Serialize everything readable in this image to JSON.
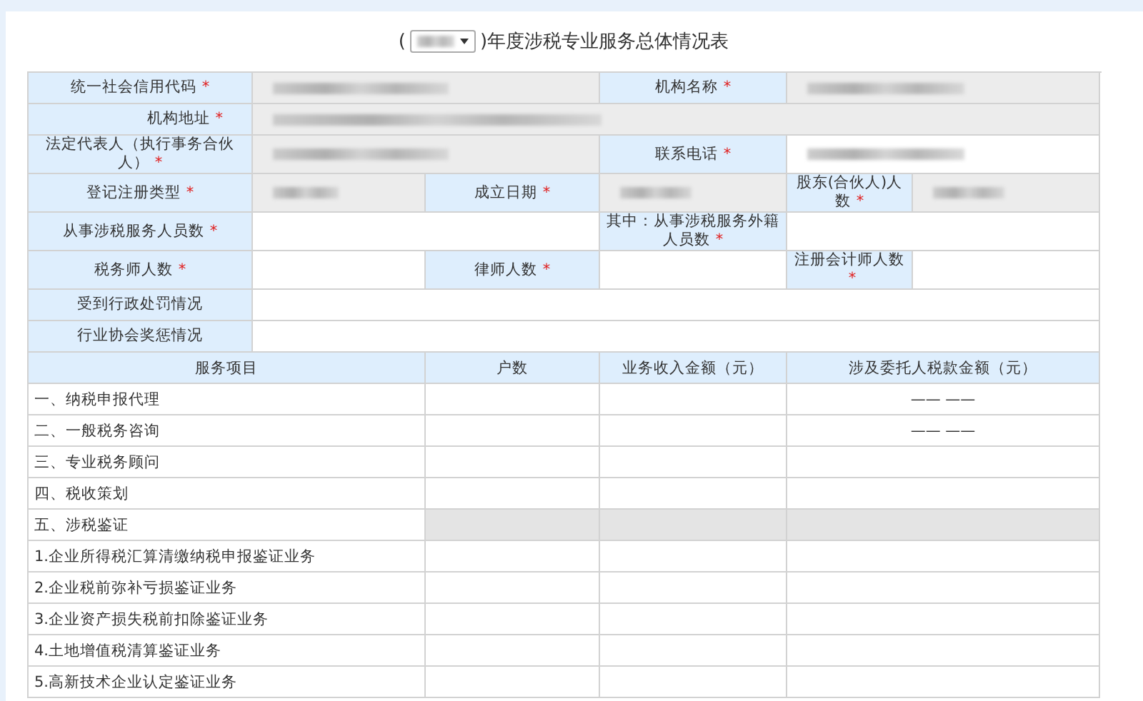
{
  "title": {
    "prefix": "(",
    "suffix": ")年度涉税专业服务总体情况表",
    "year_select": {
      "redacted": true
    }
  },
  "info_rows": [
    {
      "cells": [
        {
          "kind": "label",
          "text": "统一社会信用代码",
          "required_mark": "*"
        },
        {
          "kind": "value",
          "readonly": true,
          "redacted": true
        },
        {
          "kind": "label",
          "text": "机构名称",
          "required_mark": "*"
        },
        {
          "kind": "value",
          "readonly": true,
          "redacted": true
        }
      ]
    },
    {
      "cells": [
        {
          "kind": "label",
          "text": "机构地址",
          "required_mark": "*"
        },
        {
          "kind": "value",
          "readonly": true,
          "redacted": true
        }
      ]
    },
    {
      "cells": [
        {
          "kind": "label",
          "text": "法定代表人（执行事务合伙人）",
          "required_mark": "*"
        },
        {
          "kind": "value",
          "readonly": true,
          "redacted": true
        },
        {
          "kind": "label",
          "text": "联系电话",
          "required_mark": "*"
        },
        {
          "kind": "value",
          "readonly": false,
          "redacted": true
        }
      ]
    },
    {
      "cells": [
        {
          "kind": "label",
          "text": "登记注册类型",
          "required_mark": "*"
        },
        {
          "kind": "value",
          "readonly": true,
          "redacted": true
        },
        {
          "kind": "label",
          "text": "成立日期",
          "required_mark": "*"
        },
        {
          "kind": "value",
          "readonly": true,
          "redacted": true
        },
        {
          "kind": "label",
          "text": "股东(合伙人)人数",
          "required_mark": "*"
        },
        {
          "kind": "value",
          "readonly": true,
          "redacted": true
        }
      ]
    },
    {
      "cells": [
        {
          "kind": "label",
          "text": "从事涉税服务人员数",
          "required_mark": "*"
        },
        {
          "kind": "value",
          "readonly": false,
          "redacted": false
        },
        {
          "kind": "label",
          "text": "其中：从事涉税服务外籍人员数",
          "required_mark": "*"
        },
        {
          "kind": "value",
          "readonly": false,
          "redacted": false
        }
      ]
    },
    {
      "cells": [
        {
          "kind": "label",
          "text": "税务师人数",
          "required_mark": "*"
        },
        {
          "kind": "value",
          "readonly": false,
          "redacted": false
        },
        {
          "kind": "label",
          "text": "律师人数",
          "required_mark": "*"
        },
        {
          "kind": "value",
          "readonly": false,
          "redacted": false
        },
        {
          "kind": "label",
          "text": "注册会计师人数",
          "required_mark": "*"
        },
        {
          "kind": "value",
          "readonly": false,
          "redacted": false
        }
      ]
    },
    {
      "cells": [
        {
          "kind": "label",
          "text": "受到行政处罚情况"
        },
        {
          "kind": "value",
          "readonly": false,
          "redacted": false
        }
      ]
    },
    {
      "cells": [
        {
          "kind": "label",
          "text": "行业协会奖惩情况"
        },
        {
          "kind": "value",
          "readonly": false,
          "redacted": false
        }
      ]
    }
  ],
  "services": {
    "columns": [
      "服务项目",
      "户数",
      "业务收入金额（元）",
      "涉及委托人税款金额（元）"
    ],
    "rows": [
      {
        "item": "一、纳税申报代理",
        "disabled": false,
        "tax_amount": "—— ——"
      },
      {
        "item": "二、一般税务咨询",
        "disabled": false,
        "tax_amount": "—— ——"
      },
      {
        "item": "三、专业税务顾问",
        "disabled": false
      },
      {
        "item": "四、税收策划",
        "disabled": false
      },
      {
        "item": "五、涉税鉴证",
        "disabled": true
      },
      {
        "item": "1.企业所得税汇算清缴纳税申报鉴证业务",
        "disabled": false
      },
      {
        "item": "2.企业税前弥补亏损鉴证业务",
        "disabled": false
      },
      {
        "item": "3.企业资产损失税前扣除鉴证业务",
        "disabled": false
      },
      {
        "item": "4.土地增值税清算鉴证业务",
        "disabled": false
      },
      {
        "item": "5.高新技术企业认定鉴证业务",
        "disabled": false
      }
    ]
  }
}
